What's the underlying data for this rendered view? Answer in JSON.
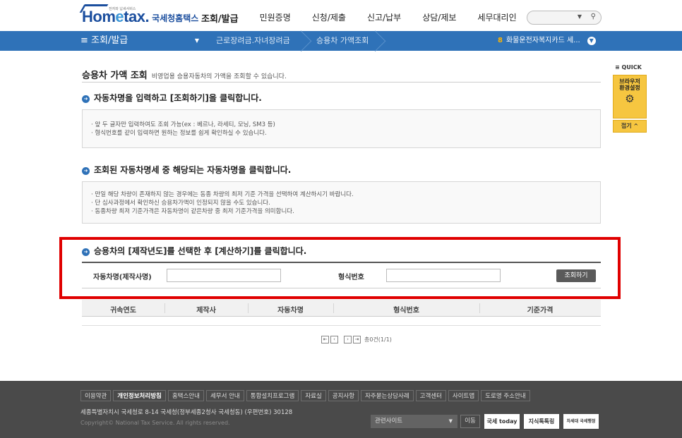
{
  "header": {
    "logo_text_main": "Hom",
    "logo_text_e": "e",
    "logo_text_tail": "tax.",
    "logo_text_ko": "국세청홈택스",
    "logo_tiny": "전자와 납세서비스",
    "nav": [
      "조회/발급",
      "민원증명",
      "신청/제출",
      "신고/납부",
      "상담/제보",
      "세무대리인"
    ],
    "search_placeholder": ""
  },
  "locbar": {
    "menu_label": "≡  조회/발급",
    "crumbs": [
      "근로장려금.자녀장려금",
      "승용차 가액조회"
    ],
    "right_num": "8",
    "right_text": "화물운전자복지카드 세..."
  },
  "page": {
    "title": "승용차 가액 조회",
    "subtitle": "비영업용 승용자동차의 가액을 조회할 수 있습니다.",
    "step1": "자동차명을 입력하고 [조회하기]을 클릭합니다.",
    "box1": [
      "· 앞 두 글자만 입력하여도 조회 가능(ex : 베르나, 라세티, 모닝, SM3 등)",
      "· 형식번호를 같이 입력하면 원하는 정보를 쉽게 확인하실 수 있습니다."
    ],
    "step2": "조회된 자동차명세 중 해당되는 자동차명을 클릭합니다.",
    "box2": [
      "· 만일 해당 차량이 존재하지 않는 경우에는 동종 차량의 최저 기준 가격을 선택하여 계산하시기 바랍니다.",
      "· 단 심사과정에서 확인하신 승용차가액이 인정되지 않을 수도 있습니다.",
      "· 동종차량 최저 기준가격은 자동차명이 같은차량 중  최저 기준가격을 의미합니다."
    ],
    "step3": "승용차의 [제작년도]를 선택한 후 [계산하기]를 클릭합니다.",
    "label_car": "자동차명(제작사명)",
    "label_type": "형식번호",
    "search_btn": "조회하기",
    "columns": [
      "귀속연도",
      "제작사",
      "자동차명",
      "형식번호",
      "기준가격"
    ],
    "pager_text": "총0건(1/1)"
  },
  "quick": {
    "title": "≡ QUICK",
    "line1": "브라우저",
    "line2": "환경설정",
    "fold": "접기 ^"
  },
  "footer": {
    "links": [
      "이용약관",
      "개인정보처리방침",
      "홈택스안내",
      "세무서 안내",
      "통합설치프로그램",
      "자료실",
      "공지사항",
      "자주묻는상담사례",
      "고객센터",
      "사이트맵",
      "도로명 주소안내"
    ],
    "address": "세종특별자치시 국세청로 8-14 국세청(정부세종2청사 국세청동) (우편번호) 30128",
    "copyright": "Copyright© National Tax Service. All rights reserved.",
    "related": "관련사이트",
    "move": "이동",
    "banner1": "국세 today",
    "banner2": "지식톡톡링",
    "banner3": "차세대 국세행정"
  }
}
